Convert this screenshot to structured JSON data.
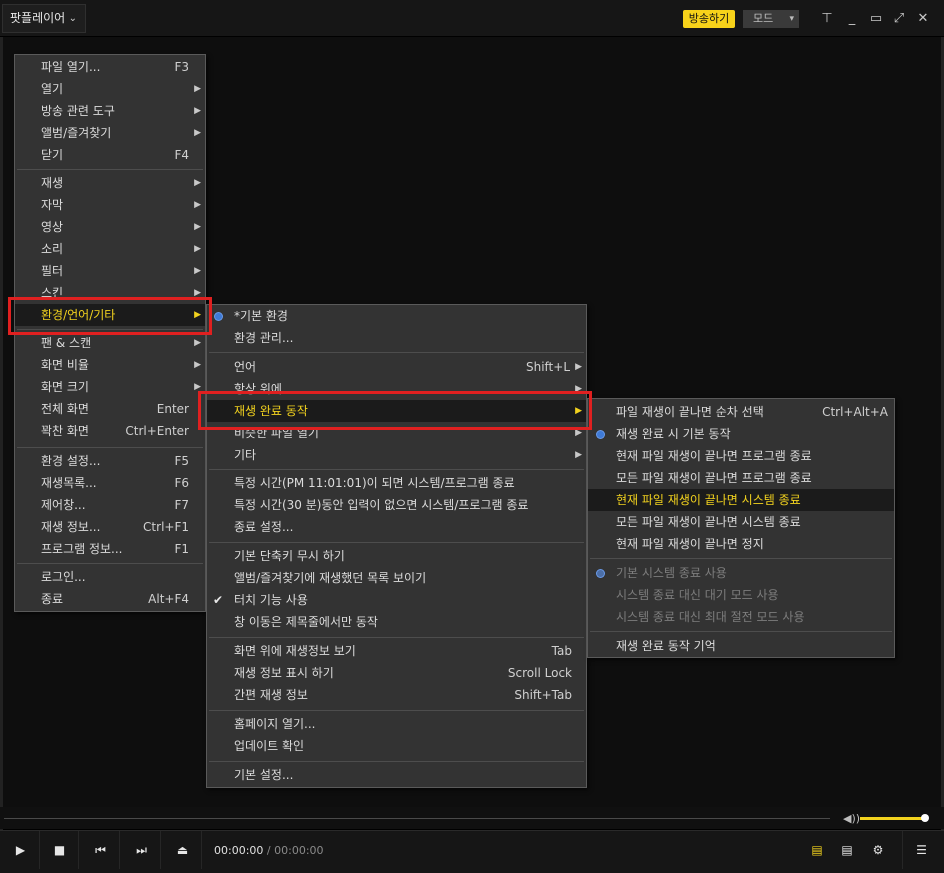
{
  "app": {
    "menu_label": "팟플레이어",
    "chevron": "⌄"
  },
  "header": {
    "broadcast_label": "방송하기",
    "mode_label": "모드",
    "pin_icon": "pin-icon",
    "minimize_icon": "minimize-icon",
    "maximize_icon": "maximize-icon",
    "fullscreen_icon": "fullscreen-icon",
    "close_icon": "close-icon"
  },
  "main_menu": [
    {
      "label": "파일 열기...",
      "shortcut": "F3"
    },
    {
      "label": "열기",
      "arrow": true
    },
    {
      "label": "방송 관련 도구",
      "arrow": true
    },
    {
      "label": "앨범/즐겨찾기",
      "arrow": true
    },
    {
      "label": "닫기",
      "shortcut": "F4"
    },
    {
      "label": "재생",
      "arrow": true
    },
    {
      "label": "자막",
      "arrow": true
    },
    {
      "label": "영상",
      "arrow": true
    },
    {
      "label": "소리",
      "arrow": true
    },
    {
      "label": "필터",
      "arrow": true
    },
    {
      "label": "스킨",
      "arrow": true
    },
    {
      "label": "환경/언어/기타",
      "arrow": true,
      "highlighted": true
    },
    {
      "label": "팬 & 스캔",
      "arrow": true
    },
    {
      "label": "화면 비율",
      "arrow": true
    },
    {
      "label": "화면 크기",
      "arrow": true
    },
    {
      "label": "전체 화면",
      "shortcut": "Enter"
    },
    {
      "label": "꽉찬 화면",
      "shortcut": "Ctrl+Enter"
    },
    {
      "label": "환경 설정...",
      "shortcut": "F5"
    },
    {
      "label": "재생목록...",
      "shortcut": "F6"
    },
    {
      "label": "제어창...",
      "shortcut": "F7"
    },
    {
      "label": "재생 정보...",
      "shortcut": "Ctrl+F1"
    },
    {
      "label": "프로그램 정보...",
      "shortcut": "F1"
    },
    {
      "label": "로그인..."
    },
    {
      "label": "종료",
      "shortcut": "Alt+F4"
    }
  ],
  "sub_menu": [
    {
      "label": "*기본 환경",
      "radio": true
    },
    {
      "label": "환경 관리..."
    },
    {
      "label": "언어",
      "shortcut": "Shift+L",
      "arrow": true
    },
    {
      "label": "항상 위에",
      "arrow": true
    },
    {
      "label": "재생 완료 동작",
      "arrow": true,
      "highlighted": true
    },
    {
      "label": "비슷한 파일 열기",
      "arrow": true
    },
    {
      "label": "기타",
      "arrow": true
    },
    {
      "label": "특정 시간(PM 11:01:01)이 되면 시스템/프로그램 종료"
    },
    {
      "label": "특정 시간(30 분)동안 입력이 없으면 시스템/프로그램 종료"
    },
    {
      "label": "종료 설정..."
    },
    {
      "label": "기본 단축키 무시 하기"
    },
    {
      "label": "앨범/즐겨찾기에 재생했던 목록 보이기"
    },
    {
      "label": "터치 기능 사용",
      "checked": true
    },
    {
      "label": "창 이동은 제목줄에서만 동작"
    },
    {
      "label": "화면 위에 재생정보 보기",
      "shortcut": "Tab"
    },
    {
      "label": "재생 정보 표시 하기",
      "shortcut": "Scroll Lock"
    },
    {
      "label": "간편 재생 정보",
      "shortcut": "Shift+Tab"
    },
    {
      "label": "홈페이지 열기..."
    },
    {
      "label": "업데이트 확인"
    },
    {
      "label": "기본 설정..."
    }
  ],
  "sub_sub_menu": [
    {
      "label": "파일 재생이 끝나면 순차 선택",
      "shortcut": "Ctrl+Alt+A"
    },
    {
      "label": "재생 완료 시 기본 동작",
      "radio": true
    },
    {
      "label": "현재 파일 재생이 끝나면 프로그램 종료"
    },
    {
      "label": "모든 파일 재생이 끝나면 프로그램 종료"
    },
    {
      "label": "현재 파일 재생이 끝나면 시스템 종료",
      "highlighted": true
    },
    {
      "label": "모든 파일 재생이 끝나면 시스템 종료"
    },
    {
      "label": "현재 파일 재생이 끝나면 정지"
    },
    {
      "label": "기본 시스템 종료 사용",
      "radio": true,
      "disabled": true
    },
    {
      "label": "시스템 종료 대신 대기 모드 사용",
      "disabled": true
    },
    {
      "label": "시스템 종료 대신 최대 절전 모드 사용",
      "disabled": true
    },
    {
      "label": "재생 완료 동작 기억"
    }
  ],
  "player": {
    "time_current": "00:00:00",
    "time_separator": "/",
    "time_total": "00:00:00",
    "volume_level": 0.92,
    "accent_color": "#f2d21e",
    "buttons": [
      "play-icon",
      "stop-icon",
      "previous-icon",
      "next-icon",
      "eject-icon",
      "playlist-search-icon",
      "playlist-icon",
      "settings-icon",
      "menu-icon"
    ],
    "glyphs": {
      "play": "▶",
      "stop": "■",
      "prev": "⏮",
      "next": "⏭",
      "eject": "⏏",
      "volume": "◀))",
      "playlist": "▤",
      "settings": "⚙",
      "menu": "☰",
      "pin": "⊤",
      "minimize": "_",
      "maximize": "▭",
      "fullscreen": "⤢",
      "close": "✕",
      "arrow": "▶",
      "check": "✔",
      "mode_tri": "▾"
    }
  }
}
